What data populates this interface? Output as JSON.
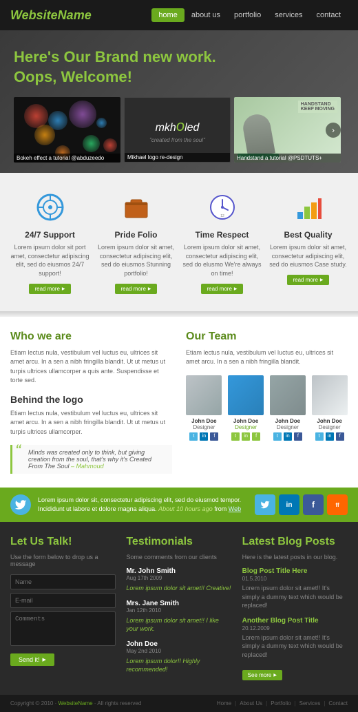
{
  "header": {
    "logo": "WebsiteName",
    "nav": [
      {
        "label": "home",
        "active": true
      },
      {
        "label": "about us",
        "active": false
      },
      {
        "label": "portfolio",
        "active": false
      },
      {
        "label": "services",
        "active": false
      },
      {
        "label": "contact",
        "active": false
      }
    ]
  },
  "hero": {
    "headline1": "Here's Our Brand new work.",
    "headline2": "Oops, ",
    "headline2_accent": "Welcome!",
    "slides": [
      {
        "caption": "Bokeh effect a tutorial @abduzeedo"
      },
      {
        "logo_text": "mkh",
        "logo_accent": "o",
        "logo_text2": "led",
        "tagline": "\"created from the soul\"",
        "caption": "Mikhael logo re-design"
      },
      {
        "caption": "Handstand a tutorial @PSDTUTS+"
      }
    ]
  },
  "features": [
    {
      "icon": "⊕",
      "title": "24/7 Support",
      "text": "Lorem ipsum dolor sit port amet, consectetur adipiscing elit, sed do eiusmos 24/7 support!",
      "button": "read more"
    },
    {
      "icon": "💼",
      "title": "Pride Folio",
      "text": "Lorem ipsum dolor sit amet, consectetur adipiscing elit, sed do eiusmos Stunning portfolio!",
      "button": "read more"
    },
    {
      "icon": "🕐",
      "title": "Time Respect",
      "text": "Lorem ipsum dolor sit amet, consectetur adipiscing elit, sed do elusmo We're always on time!",
      "button": "read more"
    },
    {
      "icon": "📊",
      "title": "Best Quality",
      "text": "Lorem ipsum dolor sit amet, consectetur adipiscing elit, sed do eiusmos Case study.",
      "button": "read more"
    }
  ],
  "about": {
    "who_title": "Who we are",
    "who_text": "Etiam lectus nula, vestibulum vel luctus eu, ultrices sit amet arcu. In a sen a nibh fringilla blandit. Ut ut metus ut turpis ultrices ullamcorper a quis ante. Suspendisse et torte sed.",
    "behind_title": "Behind the logo",
    "behind_text": "Etiam lectus nula, vestibulum vel luctus eu, ultrices sit amet arcu. In a sen a nibh fringilla blandit. Ut ut metus ut turpis ultrices ullamcorper.",
    "quote": "Minds was created only to think, but giving creation from the soul, that's why it's Created From The Soul",
    "quote_author": "– Mahmoud"
  },
  "team": {
    "title": "Our Team",
    "team_text": "Etiam lectus nula, vestibulum vel luctus eu, ultrices sit amet arcu. In a sen a nibh fringilla blandit.",
    "members": [
      {
        "name": "John Doe",
        "role": "Designer",
        "role_green": false
      },
      {
        "name": "John Doe",
        "role": "Designer",
        "role_green": true
      },
      {
        "name": "John Doe",
        "role": "Designer",
        "role_green": false
      },
      {
        "name": "John Doe",
        "role": "Designer",
        "role_green": false
      }
    ]
  },
  "tweet": {
    "text": "Lorem ipsum dolor sit, consectetur adipiscing elit, sed do eiusmod tempor. Incididunt ut labore et dolore magna aliqua.",
    "time": "About 10 hours ago",
    "from": "from",
    "link": "Web"
  },
  "contact": {
    "title": "Let Us Talk!",
    "subtitle": "Use the form below to drop us a message",
    "name_placeholder": "Name",
    "email_placeholder": "E-mail",
    "comments_placeholder": "Comments",
    "button": "Send it!"
  },
  "testimonials": {
    "title": "Testimonials",
    "subtitle": "Some comments from our clients",
    "items": [
      {
        "name": "Mr. John Smith",
        "date": "Aug 17th 2009",
        "text": "Lorem ipsum dolor sit amet!! Creative!"
      },
      {
        "name": "Mrs. Jane Smith",
        "date": "Jan 12th 2010",
        "text": "Lorem ipsum dolor sit amet!! I like your work."
      },
      {
        "name": "John Doe",
        "date": "May 2nd 2010",
        "text": "Lorem ipsum dolor!! Highly recommended!"
      }
    ]
  },
  "blog": {
    "title": "Latest Blog Posts",
    "subtitle": "Here is the latest posts in our blog.",
    "posts": [
      {
        "title": "Blog Post Title Here",
        "date": "01.5.2010",
        "text": "Lorem ipsum dolor sit amet!! It's simply a dummy text which would be replaced!"
      },
      {
        "title": "Another Blog Post Title",
        "date": "20.12.2009",
        "text": "Lorem ipsum dolor sit amet!! It's simply a dummy text which would be replaced!"
      }
    ],
    "see_more": "See more"
  },
  "footer": {
    "copy": "Copyright © 2010 · WebsiteName · All rights reserved",
    "links": [
      "Home",
      "About Us",
      "Portfolio",
      "Services",
      "Contact"
    ]
  }
}
